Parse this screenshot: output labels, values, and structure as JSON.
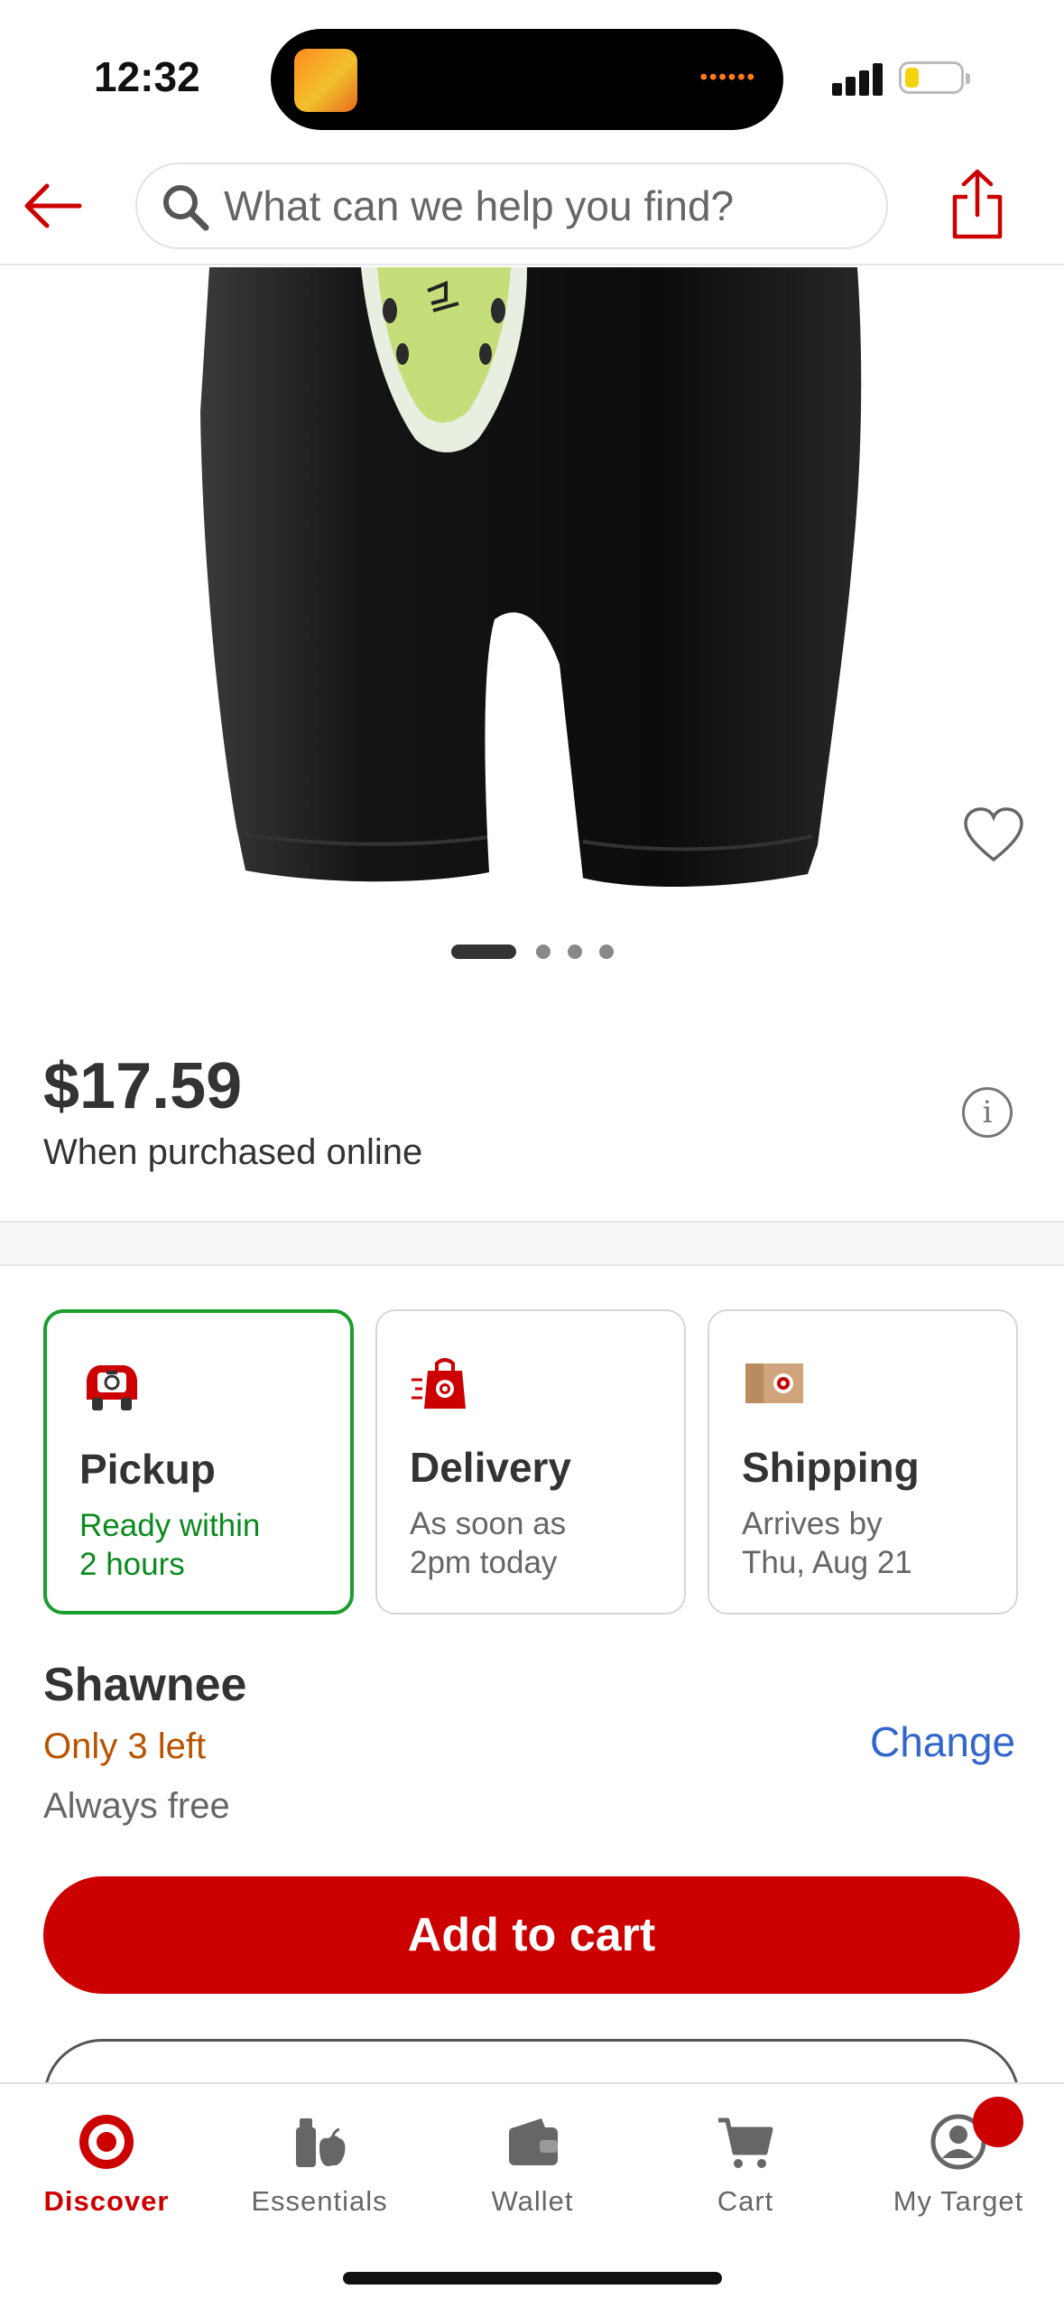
{
  "status_bar": {
    "time": "12:32",
    "battery_level": 0.25,
    "signal_bars": 4
  },
  "header": {
    "search_placeholder": "What can we help you find?",
    "back_icon": "arrow-left-icon",
    "share_icon": "share-icon"
  },
  "product": {
    "image_index": 1,
    "image_count": 4,
    "price": "$17.59",
    "price_note": "When purchased online",
    "favorited": false
  },
  "fulfillment": {
    "selected": "pickup",
    "options": [
      {
        "title": "Pickup",
        "line1": "Ready within",
        "line2": "2 hours",
        "icon": "pickup-car-icon"
      },
      {
        "title": "Delivery",
        "line1": "As soon as",
        "line2": "2pm today",
        "icon": "delivery-bag-icon"
      },
      {
        "title": "Shipping",
        "line1": "Arrives by",
        "line2": "Thu, Aug 21",
        "icon": "shipping-box-icon"
      }
    ]
  },
  "store": {
    "name": "Shawnee",
    "stock": "Only 3 left",
    "cost": "Always free",
    "change_label": "Change"
  },
  "actions": {
    "add_to_cart": "Add to cart"
  },
  "colors": {
    "brand_red": "#cc0000",
    "pickup_green": "#1a9e2f",
    "link_blue": "#3366cc",
    "stock_orange": "#b85300"
  },
  "tab_bar": {
    "active": "Discover",
    "items": [
      {
        "label": "Discover",
        "icon": "target-bullseye-icon"
      },
      {
        "label": "Essentials",
        "icon": "essentials-icon"
      },
      {
        "label": "Wallet",
        "icon": "wallet-icon"
      },
      {
        "label": "Cart",
        "icon": "cart-icon"
      },
      {
        "label": "My Target",
        "icon": "account-icon"
      }
    ]
  }
}
